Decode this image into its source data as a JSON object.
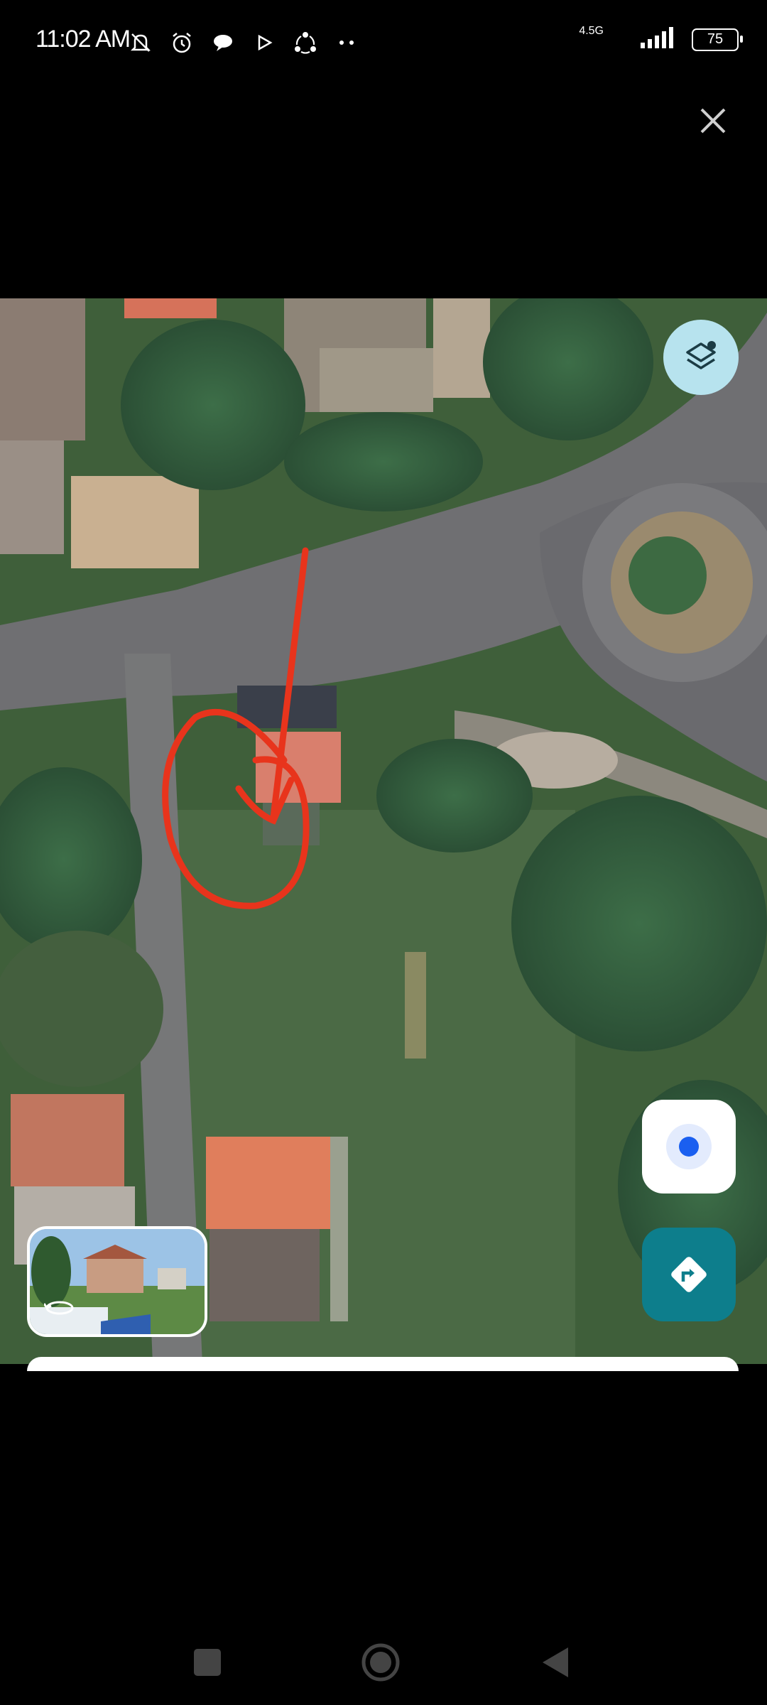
{
  "status_bar": {
    "time": "11:02 AM",
    "network": "4.5G",
    "battery": "75",
    "icons": [
      "notifications-muted-icon",
      "alarm-icon",
      "chat-icon",
      "play-icon",
      "share-icon",
      "more-dots-icon",
      "signal-icon",
      "battery-icon"
    ]
  },
  "viewer": {
    "close_icon": "close-icon"
  },
  "map": {
    "layers_icon": "layers-icon",
    "my_location_icon": "my-location-icon",
    "directions_icon": "directions-icon",
    "street_view_icon": "street-view-rotate-icon",
    "accent_color": "#0d7e8c",
    "annotation_color": "#e8341c"
  },
  "navigation": {
    "buttons": [
      "recents-button",
      "home-button",
      "back-button"
    ]
  }
}
